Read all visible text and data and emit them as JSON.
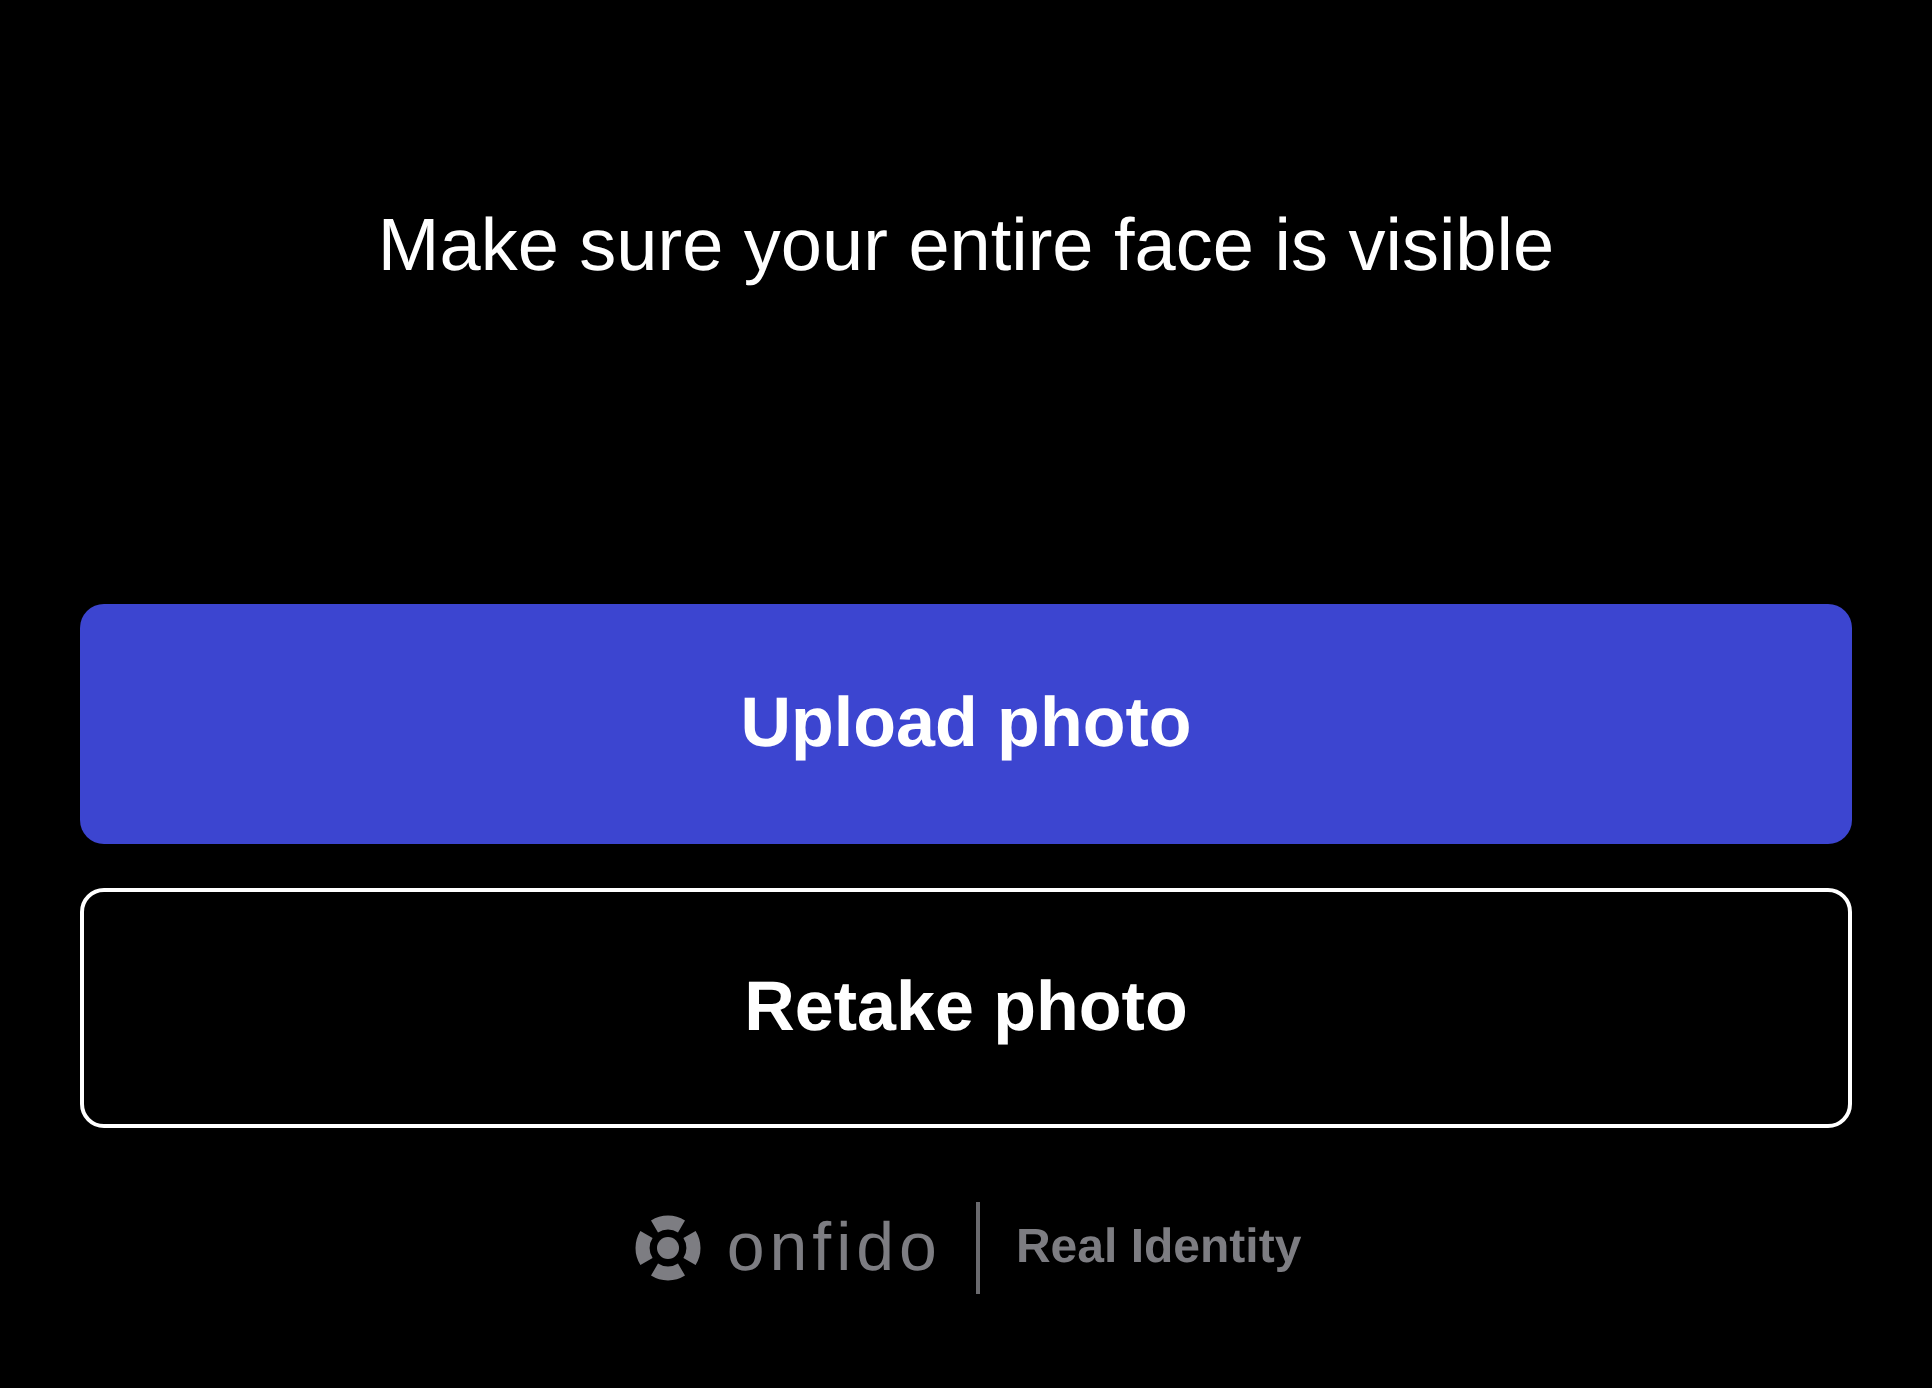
{
  "message": "Make sure your entire face is visible",
  "buttons": [
    {
      "label": "Upload photo",
      "kind": "primary"
    },
    {
      "label": "Retake photo",
      "kind": "secondary"
    }
  ],
  "footer": {
    "brand": "onfido",
    "tagline": "Real Identity"
  }
}
